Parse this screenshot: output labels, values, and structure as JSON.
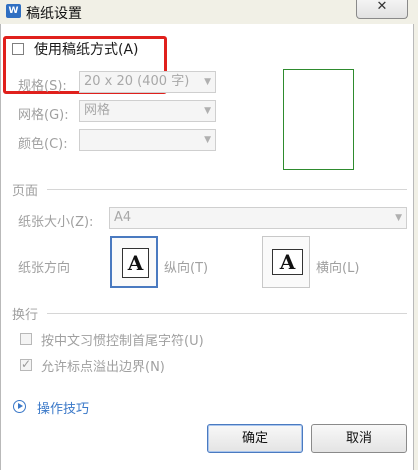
{
  "window": {
    "title": "稿纸设置",
    "app_icon": "W",
    "close_symbol": "✕"
  },
  "use_manuscript": {
    "label": "使用稿纸方式(A)",
    "checked": false
  },
  "spec": {
    "label": "规格(S):",
    "value": "20 x 20 (400 字)"
  },
  "grid": {
    "label": "网格(G):",
    "value": "网格"
  },
  "color": {
    "label": "颜色(C):",
    "value": ""
  },
  "page_section": {
    "title": "页面",
    "paper_size_label": "纸张大小(Z):",
    "paper_size_value": "A4",
    "orientation_label": "纸张方向",
    "portrait_glyph": "A",
    "portrait_label": "纵向(T)",
    "landscape_glyph": "A",
    "landscape_label": "横向(L)"
  },
  "wrap_section": {
    "title": "换行",
    "option1_label": "按中文习惯控制首尾字符(U)",
    "option1_checked": false,
    "option2_label": "允许标点溢出边界(N)",
    "option2_checked": true
  },
  "tips": {
    "label": "操作技巧"
  },
  "buttons": {
    "ok": "确定",
    "cancel": "取消"
  },
  "colors": {
    "accent": "#3a78c8",
    "highlight_box": "#e0201c",
    "preview_border": "#2e8b2e"
  }
}
